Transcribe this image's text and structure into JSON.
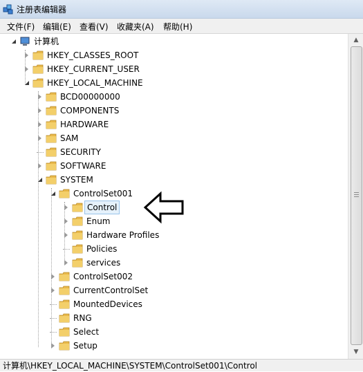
{
  "window": {
    "title": "注册表编辑器"
  },
  "menu": [
    {
      "label": "文件(F)"
    },
    {
      "label": "编辑(E)"
    },
    {
      "label": "查看(V)"
    },
    {
      "label": "收藏夹(A)"
    },
    {
      "label": "帮助(H)"
    }
  ],
  "tree": [
    {
      "label": "计算机",
      "level": 0,
      "state": "open",
      "icon": "computer-icon"
    },
    {
      "label": "HKEY_CLASSES_ROOT",
      "level": 1,
      "state": "closed"
    },
    {
      "label": "HKEY_CURRENT_USER",
      "level": 1,
      "state": "closed"
    },
    {
      "label": "HKEY_LOCAL_MACHINE",
      "level": 1,
      "state": "open"
    },
    {
      "label": "BCD00000000",
      "level": 2,
      "state": "closed"
    },
    {
      "label": "COMPONENTS",
      "level": 2,
      "state": "closed"
    },
    {
      "label": "HARDWARE",
      "level": 2,
      "state": "closed"
    },
    {
      "label": "SAM",
      "level": 2,
      "state": "closed"
    },
    {
      "label": "SECURITY",
      "level": 2,
      "state": "none"
    },
    {
      "label": "SOFTWARE",
      "level": 2,
      "state": "closed"
    },
    {
      "label": "SYSTEM",
      "level": 2,
      "state": "open"
    },
    {
      "label": "ControlSet001",
      "level": 3,
      "state": "open"
    },
    {
      "label": "Control",
      "level": 4,
      "state": "closed",
      "selected": true
    },
    {
      "label": "Enum",
      "level": 4,
      "state": "closed"
    },
    {
      "label": "Hardware Profiles",
      "level": 4,
      "state": "closed"
    },
    {
      "label": "Policies",
      "level": 4,
      "state": "none"
    },
    {
      "label": "services",
      "level": 4,
      "state": "closed"
    },
    {
      "label": "ControlSet002",
      "level": 3,
      "state": "closed"
    },
    {
      "label": "CurrentControlSet",
      "level": 3,
      "state": "closed"
    },
    {
      "label": "MountedDevices",
      "level": 3,
      "state": "none"
    },
    {
      "label": "RNG",
      "level": 3,
      "state": "none"
    },
    {
      "label": "Select",
      "level": 3,
      "state": "none"
    },
    {
      "label": "Setup",
      "level": 3,
      "state": "closed"
    }
  ],
  "status": {
    "path": "计算机\\HKEY_LOCAL_MACHINE\\SYSTEM\\ControlSet001\\Control"
  },
  "colors": {
    "folder": "#e8b84a",
    "selection_bg": "#e5f1fb",
    "selection_border": "#99c3ea"
  }
}
